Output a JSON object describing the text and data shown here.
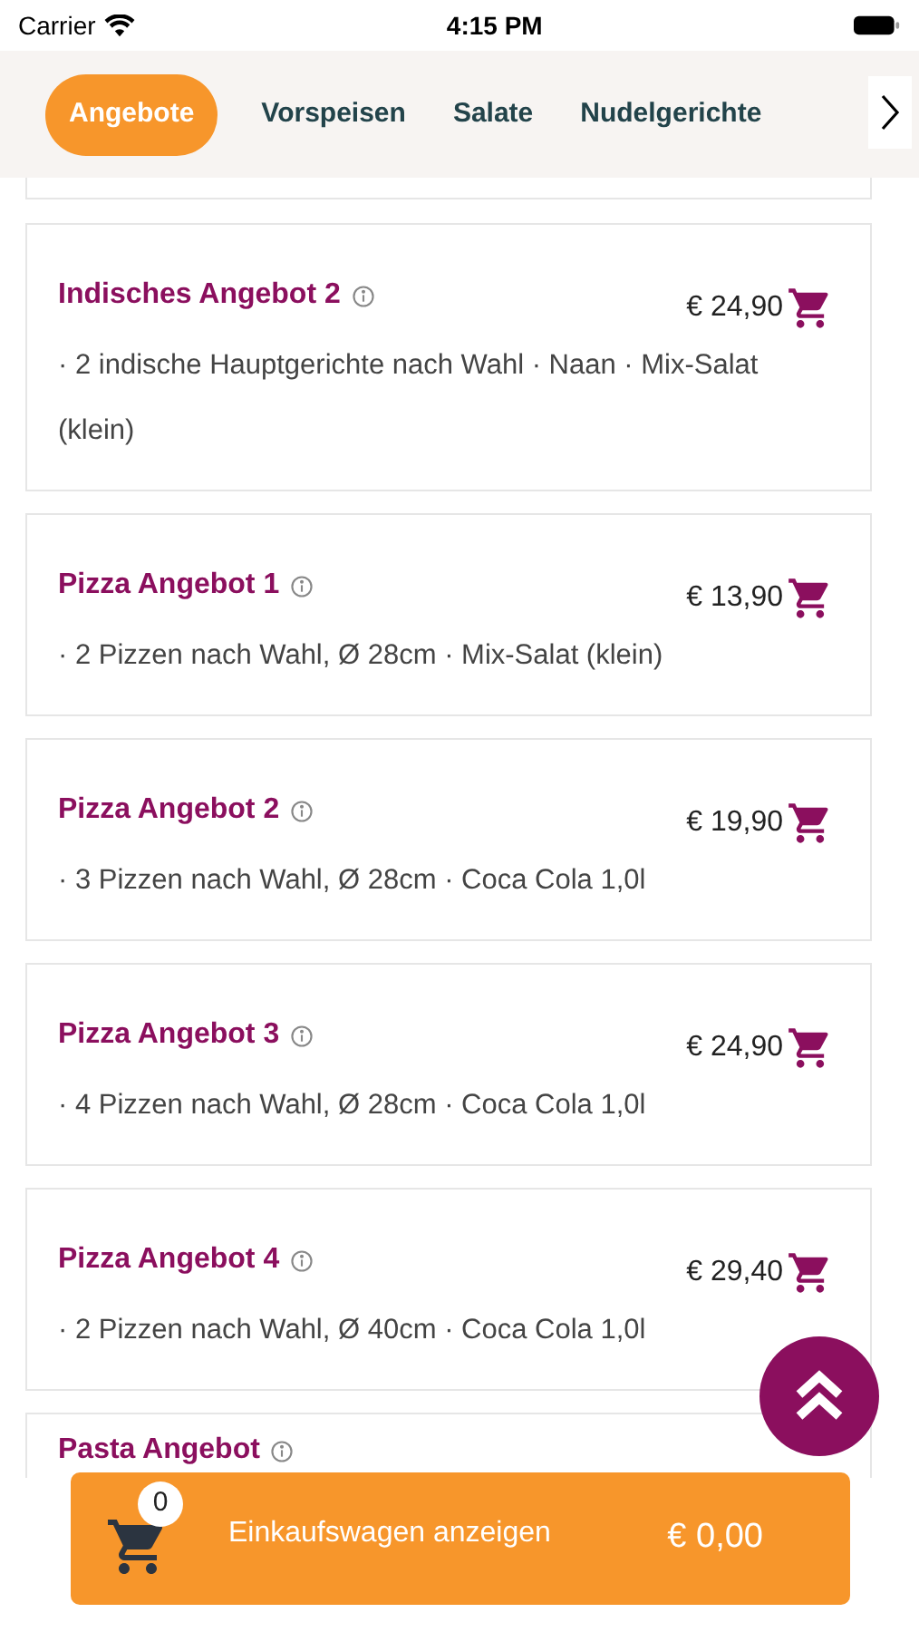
{
  "status_bar": {
    "carrier": "Carrier",
    "time": "4:15 PM"
  },
  "tabs": [
    {
      "label": "Angebote",
      "selected": true
    },
    {
      "label": "Vorspeisen",
      "selected": false
    },
    {
      "label": "Salate",
      "selected": false
    },
    {
      "label": "Nudelgerichte",
      "selected": false
    }
  ],
  "offers": [
    {
      "title": "Indisches Angebot 2",
      "price": "€ 24,90",
      "description": "· 2 indische Hauptgerichte nach Wahl · Naan · Mix-Salat (klein)"
    },
    {
      "title": "Pizza Angebot 1",
      "price": "€ 13,90",
      "description": "· 2 Pizzen nach Wahl, Ø 28cm · Mix-Salat (klein)"
    },
    {
      "title": "Pizza Angebot 2",
      "price": "€ 19,90",
      "description": "· 3 Pizzen nach Wahl, Ø 28cm · Coca Cola 1,0l"
    },
    {
      "title": "Pizza Angebot 3",
      "price": "€ 24,90",
      "description": "· 4 Pizzen nach Wahl, Ø 28cm · Coca Cola 1,0l"
    },
    {
      "title": "Pizza Angebot 4",
      "price": "€ 29,40",
      "description": "· 2 Pizzen nach Wahl, Ø 40cm · Coca Cola 1,0l"
    },
    {
      "title": "Pasta Angebot"
    }
  ],
  "cart_bar": {
    "count": "0",
    "label": "Einkaufswagen anzeigen",
    "total": "€ 0,00"
  }
}
